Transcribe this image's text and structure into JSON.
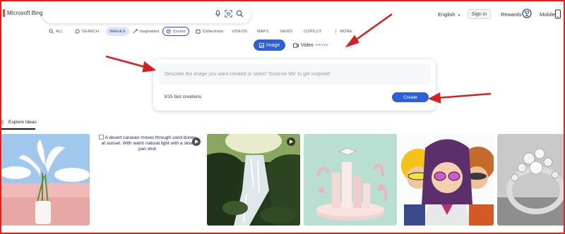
{
  "header": {
    "logo_text": "Microsoft Bing",
    "language": "English",
    "signin_label": "Sign in",
    "rewards_label": "Rewards",
    "mobile_label": "Mobile"
  },
  "nav": {
    "items": [
      {
        "label": "ALL",
        "icon": "search-icon"
      },
      {
        "label": "SEARCH",
        "icon": "copilot-search-icon"
      },
      {
        "label": "IMAGES",
        "selected": true
      },
      {
        "label": "Inspiration",
        "icon": "inspiration-icon"
      },
      {
        "label": "Create",
        "icon": "create-icon"
      },
      {
        "label": "Collections",
        "icon": "collections-icon"
      },
      {
        "label": "VIDEOS"
      },
      {
        "label": "MAPS"
      },
      {
        "label": "NEWS"
      },
      {
        "label": "COPILOT"
      },
      {
        "label": "MORE",
        "icon": "more-icon"
      }
    ]
  },
  "mode_toggle": {
    "image_label": "Image",
    "video_label": "Video",
    "video_badge": "PREVIEW"
  },
  "create_card": {
    "placeholder": "Describe the image you want created or select 'Surprise Me' to get inspired!",
    "fast_creations": "3/15 fast creations",
    "create_label": "Create"
  },
  "explore": {
    "tab_label": "Explore Ideas",
    "broken_image_alt": "A desert caravan moves through sand dunes at sunset. With warm natural light with a slow pan shot"
  },
  "colors": {
    "accent": "#2f5fd8",
    "annotation_arrows": "#d42020",
    "screenshot_border": "#e02020"
  }
}
